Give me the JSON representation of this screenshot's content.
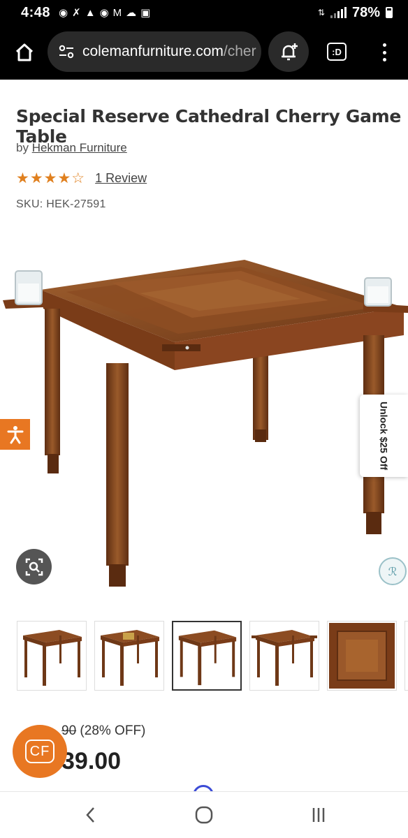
{
  "status_bar": {
    "time": "4:48",
    "battery": "78%",
    "notification_icons": [
      "facebook-icon",
      "missed-call-icon",
      "bell-icon",
      "messenger-icon",
      "gmail-icon",
      "cloud-icon",
      "image-icon"
    ]
  },
  "browser": {
    "url_host": "colemanfurniture.com",
    "url_path": "/cher",
    "tab_label": ":D"
  },
  "product": {
    "title": "Special Reserve Cathedral Cherry Game Table",
    "by_prefix": "by",
    "brand": "Hekman Furniture",
    "stars": "★★★★☆",
    "rating": 4,
    "reviews_label": "1 Review",
    "sku": "SKU: HEK-27591"
  },
  "overlays": {
    "unlock_text": "Unlock $25 Off",
    "cf_label": "CF"
  },
  "thumbnails": {
    "count": 5,
    "selected_index": 2,
    "items": [
      "table-angle-1",
      "table-angle-2",
      "table-angle-3",
      "table-angle-4",
      "tabletop-closeup"
    ]
  },
  "price": {
    "old_visible": "90",
    "discount": "(28% OFF)",
    "new_visible": "39.00"
  },
  "colors": {
    "accent_orange": "#e87722",
    "wood": "#8a4a22",
    "star": "#e0801f"
  }
}
